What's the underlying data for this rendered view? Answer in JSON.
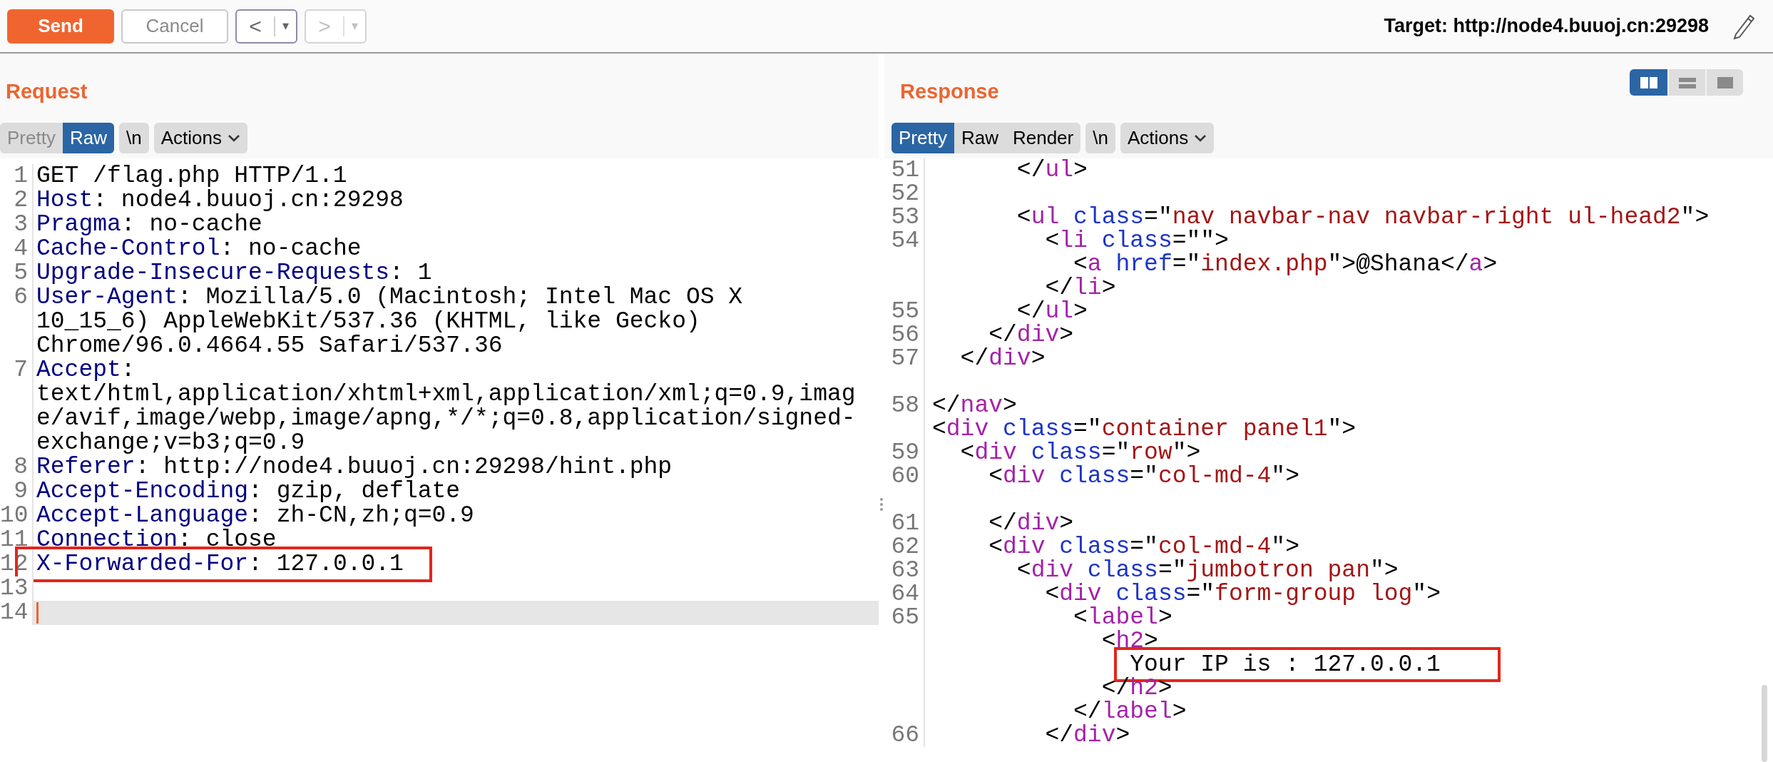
{
  "toolbar": {
    "send": "Send",
    "cancel": "Cancel",
    "back": {
      "label": "<",
      "menu": "▾",
      "disabled": false
    },
    "forward": {
      "label": ">",
      "menu": "▾",
      "disabled": true
    },
    "target": "Target: http://node4.buuoj.cn:29298"
  },
  "layout_toggle": [
    {
      "kind": "columns",
      "selected": true
    },
    {
      "kind": "rows",
      "selected": false
    },
    {
      "kind": "single",
      "selected": false
    }
  ],
  "request": {
    "title": "Request",
    "view_tabs": [
      {
        "label": "Pretty",
        "selected": false
      },
      {
        "label": "Raw",
        "selected": true
      }
    ],
    "newline_button": "\\n",
    "actions": "Actions",
    "lines": [
      {
        "number": "1",
        "current": false,
        "boxed": false,
        "segments": [
          {
            "kind": "plain",
            "text": "GET /flag.php HTTP/1.1"
          }
        ]
      },
      {
        "number": "2",
        "current": false,
        "boxed": false,
        "segments": [
          {
            "kind": "name",
            "text": "Host"
          },
          {
            "kind": "plain",
            "text": ": node4.buuoj.cn:29298"
          }
        ]
      },
      {
        "number": "3",
        "current": false,
        "boxed": false,
        "segments": [
          {
            "kind": "name",
            "text": "Pragma"
          },
          {
            "kind": "plain",
            "text": ": no-cache"
          }
        ]
      },
      {
        "number": "4",
        "current": false,
        "boxed": false,
        "segments": [
          {
            "kind": "name",
            "text": "Cache-Control"
          },
          {
            "kind": "plain",
            "text": ": no-cache"
          }
        ]
      },
      {
        "number": "5",
        "current": false,
        "boxed": false,
        "segments": [
          {
            "kind": "name",
            "text": "Upgrade-Insecure-Requests"
          },
          {
            "kind": "plain",
            "text": ": 1"
          }
        ]
      },
      {
        "number": "6",
        "current": false,
        "boxed": false,
        "segments": [
          {
            "kind": "name",
            "text": "User-Agent"
          },
          {
            "kind": "plain",
            "text": ": Mozilla/5.0 (Macintosh; Intel Mac OS X"
          }
        ]
      },
      {
        "current": false,
        "boxed": false,
        "segments": [
          {
            "kind": "plain",
            "text": "10_15_6) AppleWebKit/537.36 (KHTML, like Gecko)"
          }
        ]
      },
      {
        "current": false,
        "boxed": false,
        "segments": [
          {
            "kind": "plain",
            "text": "Chrome/96.0.4664.55 Safari/537.36"
          }
        ]
      },
      {
        "number": "7",
        "current": false,
        "boxed": false,
        "segments": [
          {
            "kind": "name",
            "text": "Accept"
          },
          {
            "kind": "plain",
            "text": ":"
          }
        ]
      },
      {
        "current": false,
        "boxed": false,
        "segments": [
          {
            "kind": "plain",
            "text": "text/html,application/xhtml+xml,application/xml;q=0.9,imag"
          }
        ]
      },
      {
        "current": false,
        "boxed": false,
        "segments": [
          {
            "kind": "plain",
            "text": "e/avif,image/webp,image/apng,*/*;q=0.8,application/signed-"
          }
        ]
      },
      {
        "current": false,
        "boxed": false,
        "segments": [
          {
            "kind": "plain",
            "text": "exchange;v=b3;q=0.9"
          }
        ]
      },
      {
        "number": "8",
        "current": false,
        "boxed": false,
        "segments": [
          {
            "kind": "name",
            "text": "Referer"
          },
          {
            "kind": "plain",
            "text": ": http://node4.buuoj.cn:29298/hint.php"
          }
        ]
      },
      {
        "number": "9",
        "current": false,
        "boxed": false,
        "segments": [
          {
            "kind": "name",
            "text": "Accept-Encoding"
          },
          {
            "kind": "plain",
            "text": ": gzip, deflate"
          }
        ]
      },
      {
        "number": "10",
        "current": false,
        "boxed": false,
        "segments": [
          {
            "kind": "name",
            "text": "Accept-Language"
          },
          {
            "kind": "plain",
            "text": ": zh-CN,zh;q=0.9"
          }
        ]
      },
      {
        "number": "11",
        "current": false,
        "boxed": false,
        "segments": [
          {
            "kind": "name",
            "text": "Connection"
          },
          {
            "kind": "plain",
            "text": ": close"
          }
        ]
      },
      {
        "number": "12",
        "current": false,
        "boxed": true,
        "segments": [
          {
            "kind": "name",
            "text": "X-Forwarded-For"
          },
          {
            "kind": "plain",
            "text": ": 127.0.0.1"
          }
        ]
      },
      {
        "number": "13",
        "current": false,
        "boxed": false
      },
      {
        "number": "14",
        "current": true,
        "boxed": false
      }
    ]
  },
  "response": {
    "title": "Response",
    "view_tabs": [
      {
        "label": "Pretty",
        "selected": true
      },
      {
        "label": "Raw",
        "selected": false
      },
      {
        "label": "Render",
        "selected": false
      }
    ],
    "newline_button": "\\n",
    "actions": "Actions",
    "lines": [
      {
        "number": "51",
        "boxed": false,
        "segments": [
          {
            "kind": "punct",
            "text": "      </"
          },
          {
            "kind": "tag",
            "text": "ul"
          },
          {
            "kind": "punct",
            "text": ">"
          }
        ]
      },
      {
        "number": "52",
        "boxed": false
      },
      {
        "number": "53",
        "boxed": false,
        "segments": [
          {
            "kind": "punct",
            "text": "      <"
          },
          {
            "kind": "tag",
            "text": "ul"
          },
          {
            "kind": "attr",
            "text": " class"
          },
          {
            "kind": "punct",
            "text": "=\""
          },
          {
            "kind": "value",
            "text": "nav navbar-nav navbar-right ul-head2"
          },
          {
            "kind": "punct",
            "text": "\">"
          }
        ]
      },
      {
        "number": "54",
        "boxed": false,
        "segments": [
          {
            "kind": "punct",
            "text": "        <"
          },
          {
            "kind": "tag",
            "text": "li"
          },
          {
            "kind": "attr",
            "text": " class"
          },
          {
            "kind": "punct",
            "text": "=\"\">"
          }
        ]
      },
      {
        "boxed": false,
        "segments": [
          {
            "kind": "punct",
            "text": "          <"
          },
          {
            "kind": "tag",
            "text": "a"
          },
          {
            "kind": "attr",
            "text": " href"
          },
          {
            "kind": "punct",
            "text": "=\""
          },
          {
            "kind": "value",
            "text": "index.php"
          },
          {
            "kind": "punct",
            "text": "\">@Shana</"
          },
          {
            "kind": "tag",
            "text": "a"
          },
          {
            "kind": "punct",
            "text": ">"
          }
        ]
      },
      {
        "boxed": false,
        "segments": [
          {
            "kind": "punct",
            "text": "        </"
          },
          {
            "kind": "tag",
            "text": "li"
          },
          {
            "kind": "punct",
            "text": ">"
          }
        ]
      },
      {
        "number": "55",
        "boxed": false,
        "segments": [
          {
            "kind": "punct",
            "text": "      </"
          },
          {
            "kind": "tag",
            "text": "ul"
          },
          {
            "kind": "punct",
            "text": ">"
          }
        ]
      },
      {
        "number": "56",
        "boxed": false,
        "segments": [
          {
            "kind": "punct",
            "text": "    </"
          },
          {
            "kind": "tag",
            "text": "div"
          },
          {
            "kind": "punct",
            "text": ">"
          }
        ]
      },
      {
        "number": "57",
        "boxed": false,
        "segments": [
          {
            "kind": "punct",
            "text": "  </"
          },
          {
            "kind": "tag",
            "text": "div"
          },
          {
            "kind": "punct",
            "text": ">"
          }
        ]
      },
      {
        "boxed": false
      },
      {
        "number": "58",
        "boxed": false,
        "segments": [
          {
            "kind": "punct",
            "text": "</"
          },
          {
            "kind": "tag",
            "text": "nav"
          },
          {
            "kind": "punct",
            "text": ">"
          }
        ]
      },
      {
        "boxed": false,
        "segments": [
          {
            "kind": "punct",
            "text": "<"
          },
          {
            "kind": "tag",
            "text": "div"
          },
          {
            "kind": "attr",
            "text": " class"
          },
          {
            "kind": "punct",
            "text": "=\""
          },
          {
            "kind": "value",
            "text": "container panel1"
          },
          {
            "kind": "punct",
            "text": "\">"
          }
        ]
      },
      {
        "number": "59",
        "boxed": false,
        "segments": [
          {
            "kind": "punct",
            "text": "  <"
          },
          {
            "kind": "tag",
            "text": "div"
          },
          {
            "kind": "attr",
            "text": " class"
          },
          {
            "kind": "punct",
            "text": "=\""
          },
          {
            "kind": "value",
            "text": "row"
          },
          {
            "kind": "punct",
            "text": "\">"
          }
        ]
      },
      {
        "number": "60",
        "boxed": false,
        "segments": [
          {
            "kind": "punct",
            "text": "    <"
          },
          {
            "kind": "tag",
            "text": "div"
          },
          {
            "kind": "attr",
            "text": " class"
          },
          {
            "kind": "punct",
            "text": "=\""
          },
          {
            "kind": "value",
            "text": "col-md-4"
          },
          {
            "kind": "punct",
            "text": "\">"
          }
        ]
      },
      {
        "boxed": false
      },
      {
        "number": "61",
        "boxed": false,
        "segments": [
          {
            "kind": "punct",
            "text": "    </"
          },
          {
            "kind": "tag",
            "text": "div"
          },
          {
            "kind": "punct",
            "text": ">"
          }
        ]
      },
      {
        "number": "62",
        "boxed": false,
        "segments": [
          {
            "kind": "punct",
            "text": "    <"
          },
          {
            "kind": "tag",
            "text": "div"
          },
          {
            "kind": "attr",
            "text": " class"
          },
          {
            "kind": "punct",
            "text": "=\""
          },
          {
            "kind": "value",
            "text": "col-md-4"
          },
          {
            "kind": "punct",
            "text": "\">"
          }
        ]
      },
      {
        "number": "63",
        "boxed": false,
        "segments": [
          {
            "kind": "punct",
            "text": "      <"
          },
          {
            "kind": "tag",
            "text": "div"
          },
          {
            "kind": "attr",
            "text": " class"
          },
          {
            "kind": "punct",
            "text": "=\""
          },
          {
            "kind": "value",
            "text": "jumbotron pan"
          },
          {
            "kind": "punct",
            "text": "\">"
          }
        ]
      },
      {
        "number": "64",
        "boxed": false,
        "segments": [
          {
            "kind": "punct",
            "text": "        <"
          },
          {
            "kind": "tag",
            "text": "div"
          },
          {
            "kind": "attr",
            "text": " class"
          },
          {
            "kind": "punct",
            "text": "=\""
          },
          {
            "kind": "value",
            "text": "form-group log"
          },
          {
            "kind": "punct",
            "text": "\">"
          }
        ]
      },
      {
        "number": "65",
        "boxed": false,
        "segments": [
          {
            "kind": "punct",
            "text": "          <"
          },
          {
            "kind": "tag",
            "text": "label"
          },
          {
            "kind": "punct",
            "text": ">"
          }
        ]
      },
      {
        "boxed": false,
        "segments": [
          {
            "kind": "punct",
            "text": "            <"
          },
          {
            "kind": "tag",
            "text": "h2"
          },
          {
            "kind": "punct",
            "text": ">"
          }
        ]
      },
      {
        "boxed": true,
        "segments": [
          {
            "kind": "punct",
            "text": "              Your IP is : 127.0.0.1"
          }
        ]
      },
      {
        "boxed": false,
        "segments": [
          {
            "kind": "punct",
            "text": "            </"
          },
          {
            "kind": "tag",
            "text": "h2"
          },
          {
            "kind": "punct",
            "text": ">"
          }
        ]
      },
      {
        "boxed": false,
        "segments": [
          {
            "kind": "punct",
            "text": "          </"
          },
          {
            "kind": "tag",
            "text": "label"
          },
          {
            "kind": "punct",
            "text": ">"
          }
        ]
      },
      {
        "number": "66",
        "boxed": false,
        "segments": [
          {
            "kind": "punct",
            "text": "        </"
          },
          {
            "kind": "tag",
            "text": "div"
          },
          {
            "kind": "punct",
            "text": ">"
          }
        ]
      }
    ]
  }
}
